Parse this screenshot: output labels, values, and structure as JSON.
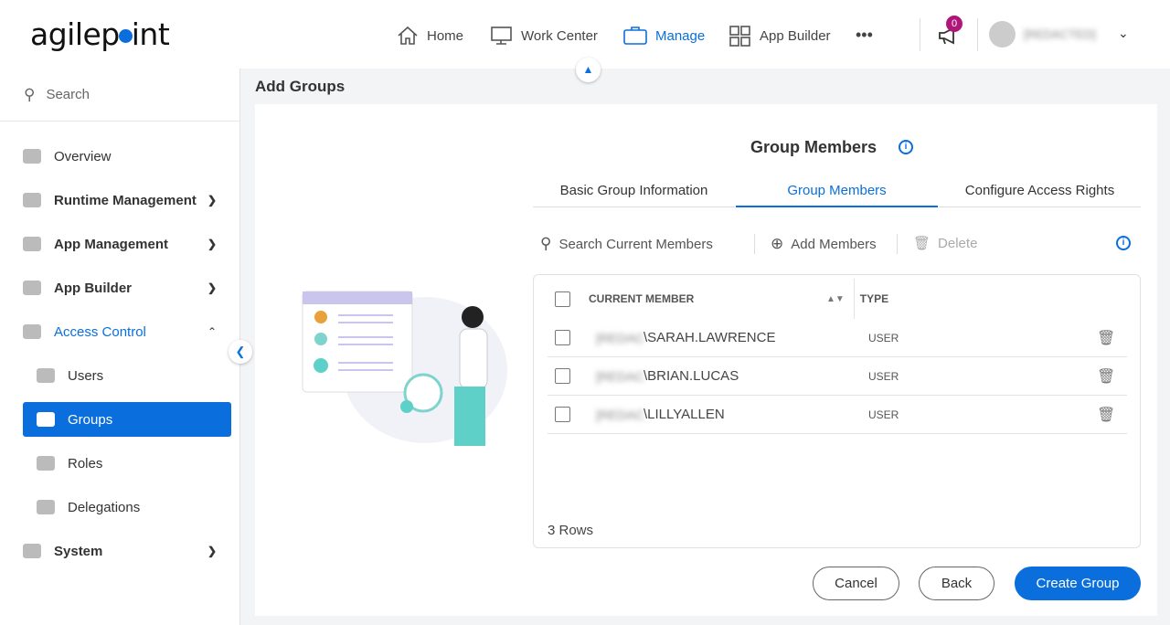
{
  "header": {
    "logo": "agilepoint",
    "nav": [
      {
        "label": "Home",
        "icon": "home-icon"
      },
      {
        "label": "Work Center",
        "icon": "monitor-icon"
      },
      {
        "label": "Manage",
        "icon": "briefcase-icon",
        "active": true
      },
      {
        "label": "App Builder",
        "icon": "grid-icon"
      }
    ],
    "more": "•••",
    "notifications": "0",
    "user_name": "[REDACTED]"
  },
  "sidebar": {
    "search_placeholder": "Search",
    "items": [
      {
        "label": "Overview"
      },
      {
        "label": "Runtime Management"
      },
      {
        "label": "App Management"
      },
      {
        "label": "App Builder"
      },
      {
        "label": "Access Control"
      },
      {
        "label": "Users"
      },
      {
        "label": "Groups"
      },
      {
        "label": "Roles"
      },
      {
        "label": "Delegations"
      },
      {
        "label": "System"
      }
    ]
  },
  "page": {
    "title": "Add Groups",
    "section_title": "Group Members",
    "tabs": [
      "Basic Group Information",
      "Group Members",
      "Configure Access Rights"
    ],
    "toolbar": {
      "search_placeholder": "Search Current Members",
      "add": "Add Members",
      "delete": "Delete"
    },
    "table": {
      "headers": [
        "CURRENT MEMBER",
        "TYPE"
      ],
      "rows": [
        {
          "domain": "[REDACTED]",
          "member": "\\SARAH.LAWRENCE",
          "type": "USER"
        },
        {
          "domain": "[REDACTED]",
          "member": "\\BRIAN.LUCAS",
          "type": "USER"
        },
        {
          "domain": "[REDACTED]",
          "member": "\\LILLYALLEN",
          "type": "USER"
        }
      ],
      "row_count": "3 Rows"
    },
    "buttons": {
      "cancel": "Cancel",
      "back": "Back",
      "create": "Create Group"
    }
  },
  "colors": {
    "accent": "#0a6fdc",
    "badge": "#b0167a"
  }
}
